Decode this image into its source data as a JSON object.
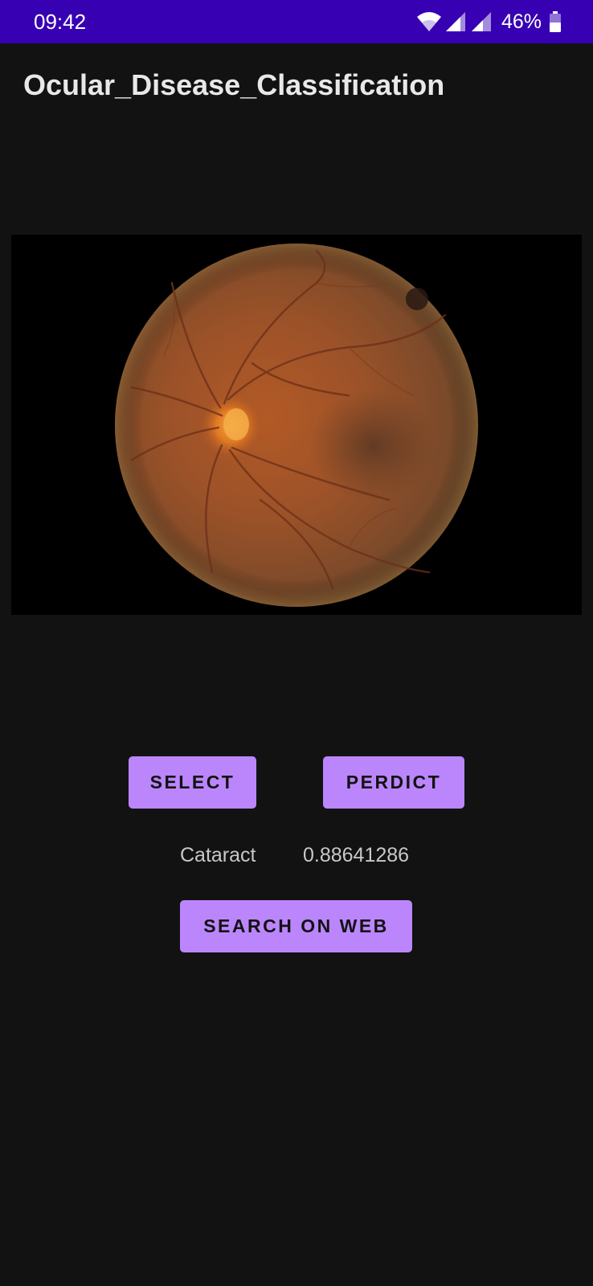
{
  "status_bar": {
    "time": "09:42",
    "battery_percent": "46%",
    "icons": [
      "wifi-icon",
      "signal-icon",
      "signal-icon",
      "battery-icon"
    ],
    "background_color": "#3700b3"
  },
  "app": {
    "title": "Ocular_Disease_Classification"
  },
  "image": {
    "description_icon": "fundus-image"
  },
  "buttons": {
    "select_label": "SELECT",
    "predict_label": "PERDICT",
    "search_label": "SEARCH ON WEB",
    "color": "#bb86fc"
  },
  "result": {
    "label": "Cataract",
    "score": "0.88641286"
  }
}
